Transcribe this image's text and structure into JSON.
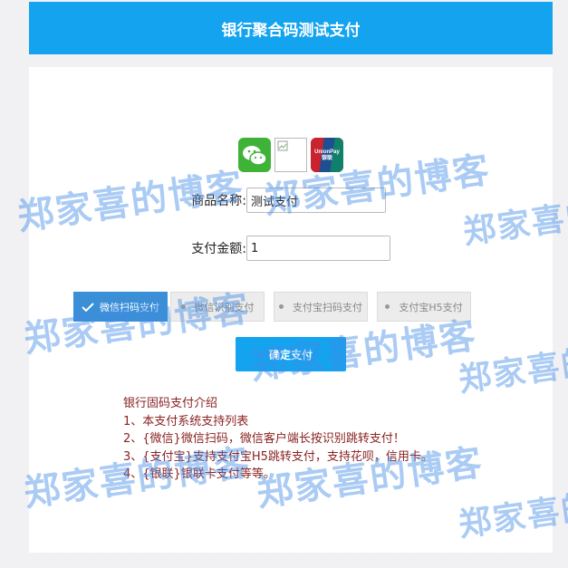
{
  "header": {
    "title": "银行聚合码测试支付"
  },
  "logos": [
    {
      "icon": "wechat-pay-icon"
    },
    {
      "icon": "broken-image-icon"
    },
    {
      "icon": "unionpay-icon",
      "text_line1": "UnionPay",
      "text_line2": "银联"
    }
  ],
  "form": {
    "product_label": "商品名称:",
    "product_value": "测试支付",
    "amount_label": "支付金额:",
    "amount_value": "1"
  },
  "payment_options": [
    {
      "label": "微信扫码支付",
      "selected": true
    },
    {
      "label": "微信识别支付",
      "selected": false
    },
    {
      "label": "支付宝扫码支付",
      "selected": false
    },
    {
      "label": "支付宝H5支付",
      "selected": false
    }
  ],
  "submit_label": "确定支付",
  "intro": {
    "title": "银行固码支付介绍",
    "lines": [
      "1、本支付系统支持列表",
      "2、{微信}微信扫码，微信客户端长按识别跳转支付！",
      "3、{支付宝}支持支付宝H5跳转支付，支持花呗，信用卡。",
      "4、{银联}银联卡支付等等。"
    ]
  },
  "watermark_text": "郑家喜的博客",
  "colors": {
    "primary": "#14a3ee",
    "selected": "#3b8fd6",
    "intro_text": "#8a2222",
    "watermark": "#428ce6"
  }
}
